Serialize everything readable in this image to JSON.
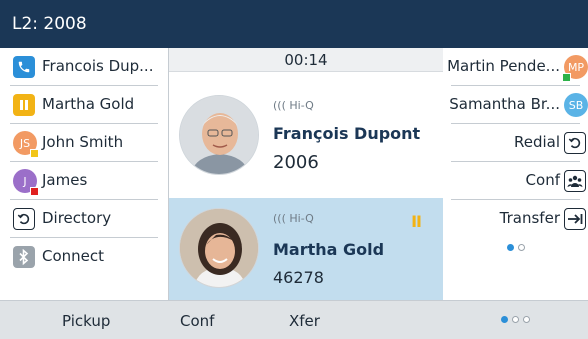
{
  "header": {
    "line_label": "L2: 2008"
  },
  "left_keys": [
    {
      "label": "Francois Dup...",
      "icon": "phone-icon",
      "color": "#2b8fd8"
    },
    {
      "label": "Martha Gold",
      "icon": "hold-icon",
      "color": "#f2b315"
    },
    {
      "label": "John Smith",
      "icon": "avatar-initials",
      "initials": "JS",
      "color": "#f29a63",
      "presence_color": "#f2c518"
    },
    {
      "label": "James",
      "icon": "avatar-initials",
      "initials": "J",
      "color": "#9b6fc9",
      "presence_color": "#e02020"
    },
    {
      "label": "Directory",
      "icon": "directory-icon"
    },
    {
      "label": "Connect",
      "icon": "bluetooth-icon",
      "color": "#9aa3ab"
    }
  ],
  "center": {
    "timer": "00:14",
    "calls": [
      {
        "badge": "Hi-Q",
        "name": "François Dupont",
        "number": "2006",
        "state": "active"
      },
      {
        "badge": "Hi-Q",
        "name": "Martha Gold",
        "number": "46278",
        "state": "hold",
        "hold_symbol": "II"
      }
    ]
  },
  "right_keys": [
    {
      "label": "Martin Pende...",
      "icon": "avatar-initials",
      "initials": "MP",
      "color": "#f29a63",
      "presence_color": "#2db24a"
    },
    {
      "label": "Samantha Br...",
      "icon": "avatar-initials",
      "initials": "SB",
      "color": "#5ab3e6"
    },
    {
      "label": "Redial",
      "icon": "redial-icon"
    },
    {
      "label": "Conf",
      "icon": "conference-icon"
    },
    {
      "label": "Transfer",
      "icon": "transfer-icon"
    }
  ],
  "right_pagination": {
    "pages": 2,
    "active": 1
  },
  "softkeys": [
    "Pickup",
    "Conf",
    "Xfer"
  ],
  "softkey_pagination": {
    "pages": 3,
    "active": 1
  },
  "colors": {
    "header_bg": "#1b3756",
    "held_call_bg": "#c2ddee",
    "accent": "#2b8fd8",
    "hold": "#f2b315"
  }
}
